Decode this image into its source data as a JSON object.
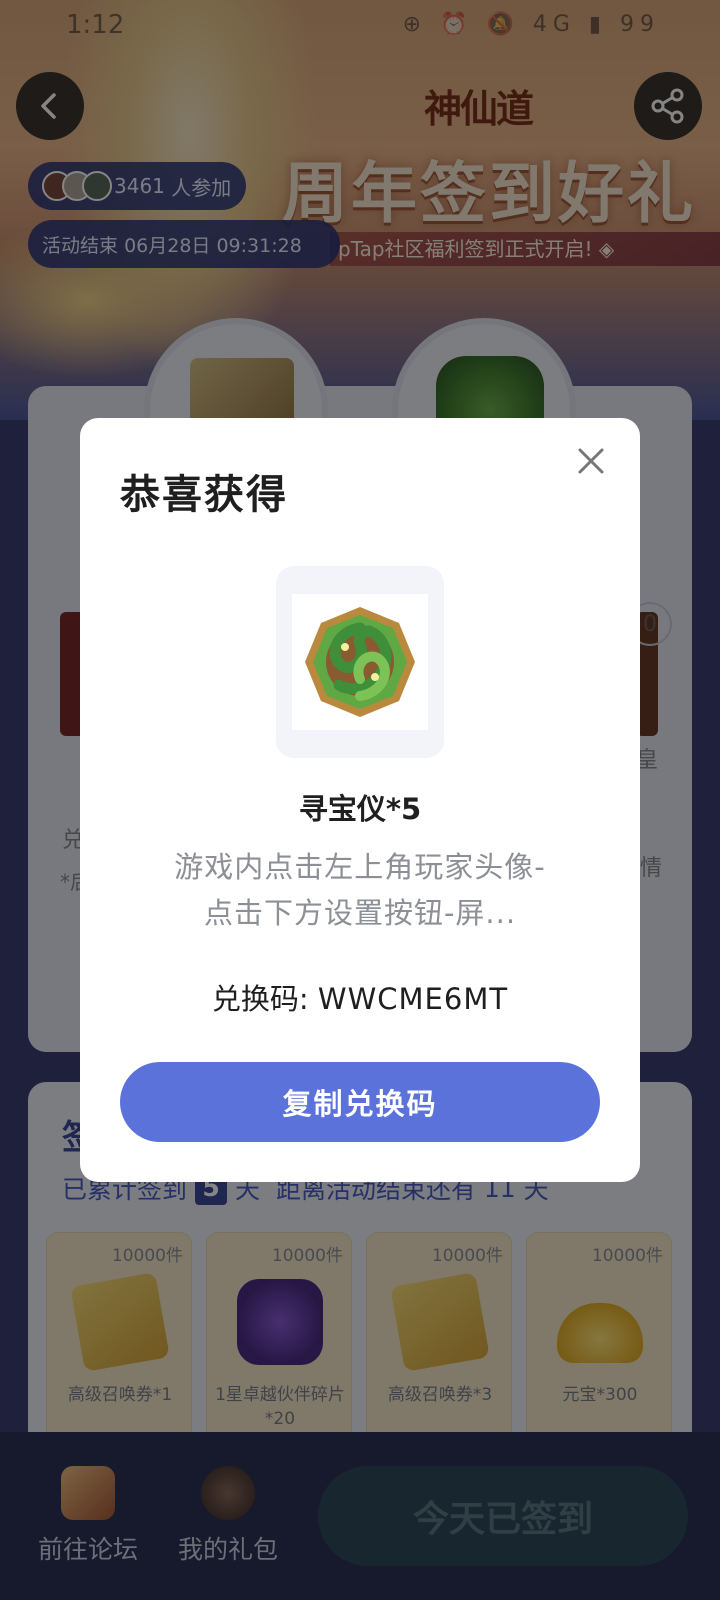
{
  "status_bar": {
    "time": "1:12",
    "icons": "⊕ ⏰ 🔕 4G ▮ 99"
  },
  "banner": {
    "logo": "神仙道",
    "title": "周年签到好礼",
    "subtitle": "pTap社区福利签到正式开启! ◈"
  },
  "participants": {
    "count": "3461",
    "suffix": "人参加"
  },
  "event_end": {
    "label": "活动结束",
    "datetime": "06月28日 09:31:28"
  },
  "prize_area": {
    "side_badge": "0",
    "right_text_1": "皇",
    "right_text_2": "情",
    "left_text_1": "兑",
    "left_text_2": "*后"
  },
  "signin": {
    "heading": "签",
    "accumulated_prefix": "已累计签到",
    "days": "5",
    "days_unit": "天",
    "remaining_prefix": "距离活动结束还有",
    "remaining_days": "11",
    "remaining_unit": "天"
  },
  "rewards": [
    {
      "count": "10000件",
      "label": "高级召唤券*1",
      "icon": "ticket-icon"
    },
    {
      "count": "10000件",
      "label": "1星卓越伙伴碎片*20",
      "icon": "puzzle-icon"
    },
    {
      "count": "10000件",
      "label": "高级召唤券*3",
      "icon": "ticket-icon"
    },
    {
      "count": "10000件",
      "label": "元宝*300",
      "icon": "gold-ingot-icon"
    }
  ],
  "bottom_nav": {
    "forum_label": "前往论坛",
    "gifts_label": "我的礼包",
    "signed_label": "今天已签到"
  },
  "modal": {
    "title": "恭喜获得",
    "item_name": "寻宝仪*5",
    "item_icon": "treasure-finder-icon",
    "description": "游戏内点击左上角玩家头像-点击下方设置按钮-屏...",
    "code_label": "兑换码:",
    "code_value": "WWCME6MT",
    "copy_label": "复制兑换码"
  },
  "colors": {
    "accent": "#5b72db",
    "dark_blue": "#3d4a9a",
    "overlay": "rgba(0,0,0,0.48)"
  }
}
